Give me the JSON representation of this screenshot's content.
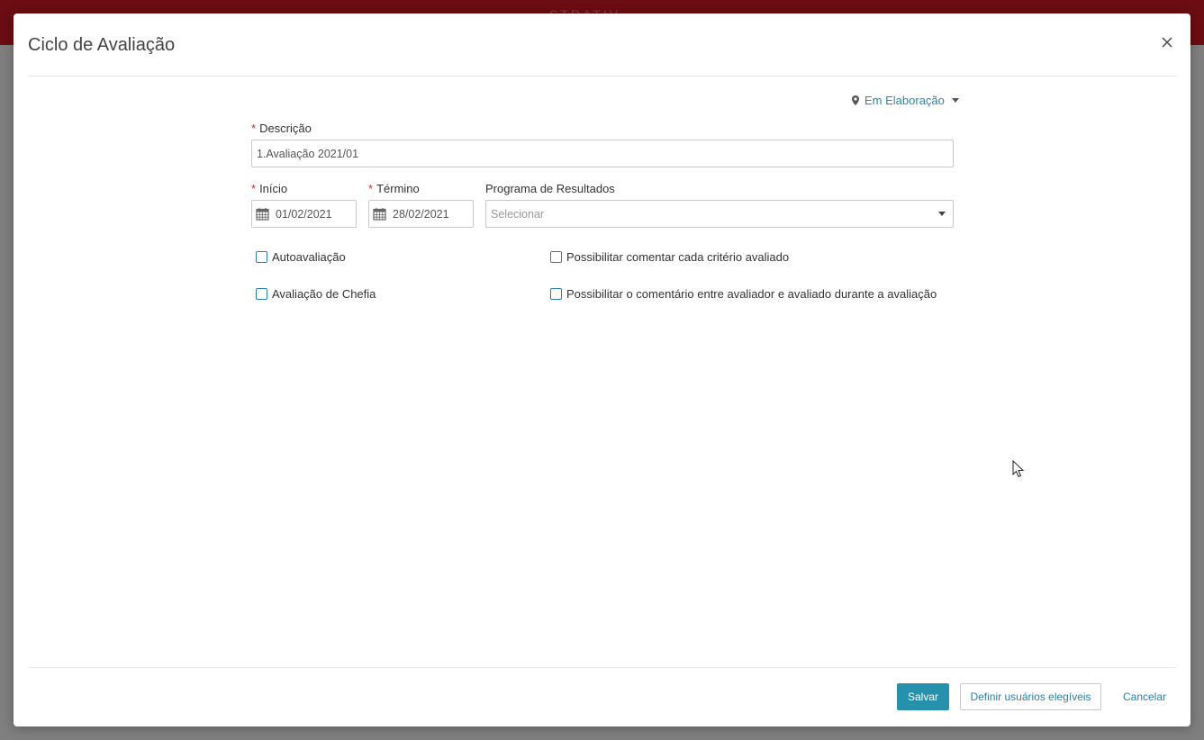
{
  "background": {
    "app_title_ghost": "STRATIV"
  },
  "modal": {
    "title": "Ciclo de Avaliação",
    "close_icon": "close-icon"
  },
  "status": {
    "icon": "map-marker-icon",
    "label": "Em Elaboração"
  },
  "form": {
    "required_mark": "*",
    "descricao": {
      "label": "Descrição",
      "value": "1.Avaliação 2021/01"
    },
    "inicio": {
      "label": "Início",
      "value": "01/02/2021",
      "icon": "calendar-icon"
    },
    "termino": {
      "label": "Término",
      "value": "28/02/2021",
      "icon": "calendar-icon"
    },
    "programa": {
      "label": "Programa de Resultados",
      "placeholder": "Selecionar"
    },
    "checkboxes": {
      "autoavaliacao": {
        "label": "Autoavaliação",
        "checked": false
      },
      "avaliacao_chefia": {
        "label": "Avaliação de Chefia",
        "checked": false
      },
      "comentar_criterio": {
        "label": "Possibilitar comentar cada critério avaliado",
        "checked": false
      },
      "comentario_avaliador": {
        "label": "Possibilitar o comentário entre avaliador e avaliado durante a avaliação",
        "checked": false
      }
    }
  },
  "footer": {
    "save_label": "Salvar",
    "eligible_label": "Definir usuários elegíveis",
    "cancel_label": "Cancelar"
  },
  "colors": {
    "topbar": "#6b0d12",
    "primary": "#2591ad",
    "link": "#2e7ea3",
    "required": "#c9302c"
  }
}
